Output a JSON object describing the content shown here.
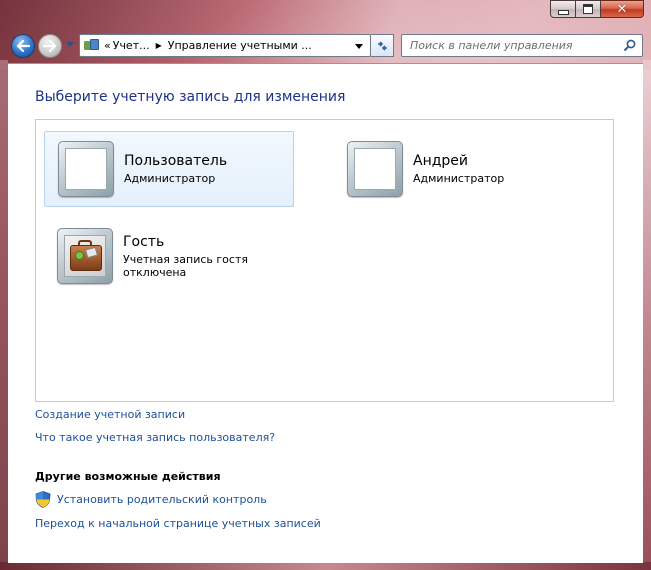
{
  "window": {
    "minimize_label": "minimize",
    "maximize_label": "maximize",
    "close_label": "close"
  },
  "address_bar": {
    "chevron": "«",
    "crumbs": [
      "Учет...",
      "Управление учетными ..."
    ]
  },
  "search": {
    "placeholder": "Поиск в панели управления"
  },
  "main": {
    "title": "Выберите учетную запись для изменения",
    "accounts": [
      {
        "name": "Пользователь",
        "role": "Администратор"
      },
      {
        "name": "Андрей",
        "role": "Администратор"
      },
      {
        "name": "Гость",
        "role": "Учетная запись гостя отключена"
      }
    ],
    "links": {
      "create": "Создание учетной записи",
      "what_is": "Что такое учетная запись пользователя?"
    },
    "other_actions": {
      "title": "Другие возможные действия",
      "parental_control": "Установить родительский контроль",
      "go_home": "Переход к начальной странице учетных записей"
    }
  }
}
